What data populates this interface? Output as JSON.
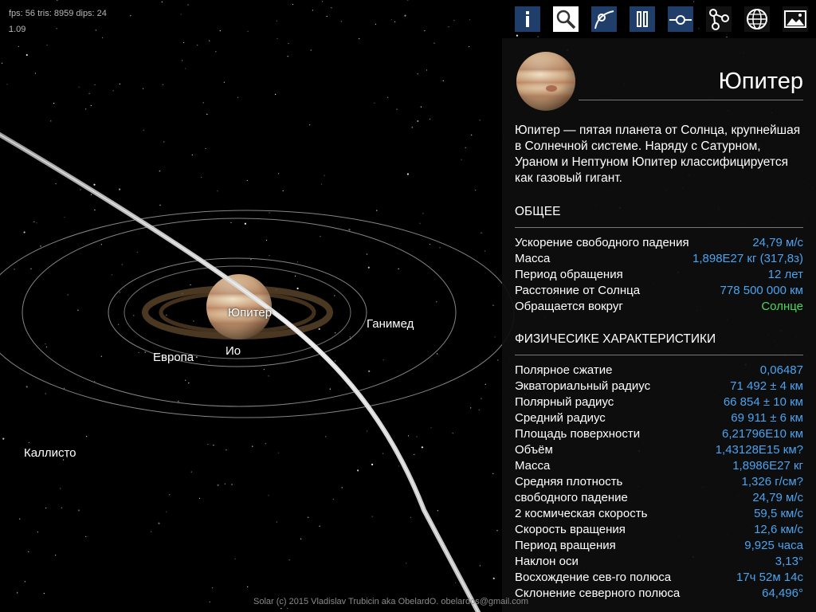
{
  "hud": {
    "stats": "fps: 56  tris: 8959  dips: 24",
    "version": "1.09"
  },
  "moons": [
    "Юпитер",
    "Ганимед",
    "Европа",
    "Ио",
    "Каллисто"
  ],
  "footer": "Solar (c) 2015 Vladislav Trubicin aka ObelardO. obelardos@gmail.com",
  "toolbar": {
    "icons": [
      "info-icon",
      "search-icon",
      "orbit-path-icon",
      "pause-icon",
      "connect-line-icon",
      "network-nodes-icon",
      "globe-icon",
      "picture-icon"
    ]
  },
  "panel": {
    "title": "Юпитер",
    "description": "Юпитер — пятая планета от Солнца, крупнейшая в Солнечной системе. Наряду с Сатурном, Ураном и Нептуном Юпитер классифицируется как газовый гигант.",
    "general_title": "ОБЩЕЕ",
    "general": [
      {
        "k": "Ускорение свободного падения",
        "v": "24,79 м/с"
      },
      {
        "k": "Масса",
        "v": "1,898E27 кг (317,8з)"
      },
      {
        "k": "Период обращения",
        "v": "12 лет"
      },
      {
        "k": "Расстояние от Солнца",
        "v": "778 500 000 км"
      },
      {
        "k": "Обращается вокруг",
        "v": "Солнце",
        "accent": "green"
      }
    ],
    "physical_title": "ФИЗИЧЕСИКЕ ХАРАКТЕРИСТИКИ",
    "physical": [
      {
        "k": "Полярное сжатие",
        "v": "0,06487"
      },
      {
        "k": "Экваториальный радиус",
        "v": "71 492 ± 4 км"
      },
      {
        "k": "Полярный радиус",
        "v": "66 854 ± 10 км"
      },
      {
        "k": "Средний радиус",
        "v": "69 911 ± 6 км"
      },
      {
        "k": "Площадь поверхности",
        "v": "6,21796E10 км"
      },
      {
        "k": "Объём",
        "v": "1,43128E15 км?"
      },
      {
        "k": "Масса",
        "v": "1,8986E27 кг"
      },
      {
        "k": "Средняя плотность",
        "v": "1,326 г/см?"
      },
      {
        "k": "свободного падение",
        "v": "24,79 м/с"
      },
      {
        "k": "2 космическая скорость",
        "v": "59,5 км/с"
      },
      {
        "k": "Скорость вращения",
        "v": "12,6 км/с"
      },
      {
        "k": "Период вращения",
        "v": "9,925 часа"
      },
      {
        "k": "Наклон оси",
        "v": "3,13°"
      },
      {
        "k": "Восхождение сев-го полюса",
        "v": "17ч 52м 14с"
      },
      {
        "k": "Склонение северного полюса",
        "v": "64,496°"
      }
    ]
  },
  "colors": {
    "accent": "#4aa3f0",
    "green": "#49d85a",
    "toolbar_active": "#1f3f6a"
  }
}
